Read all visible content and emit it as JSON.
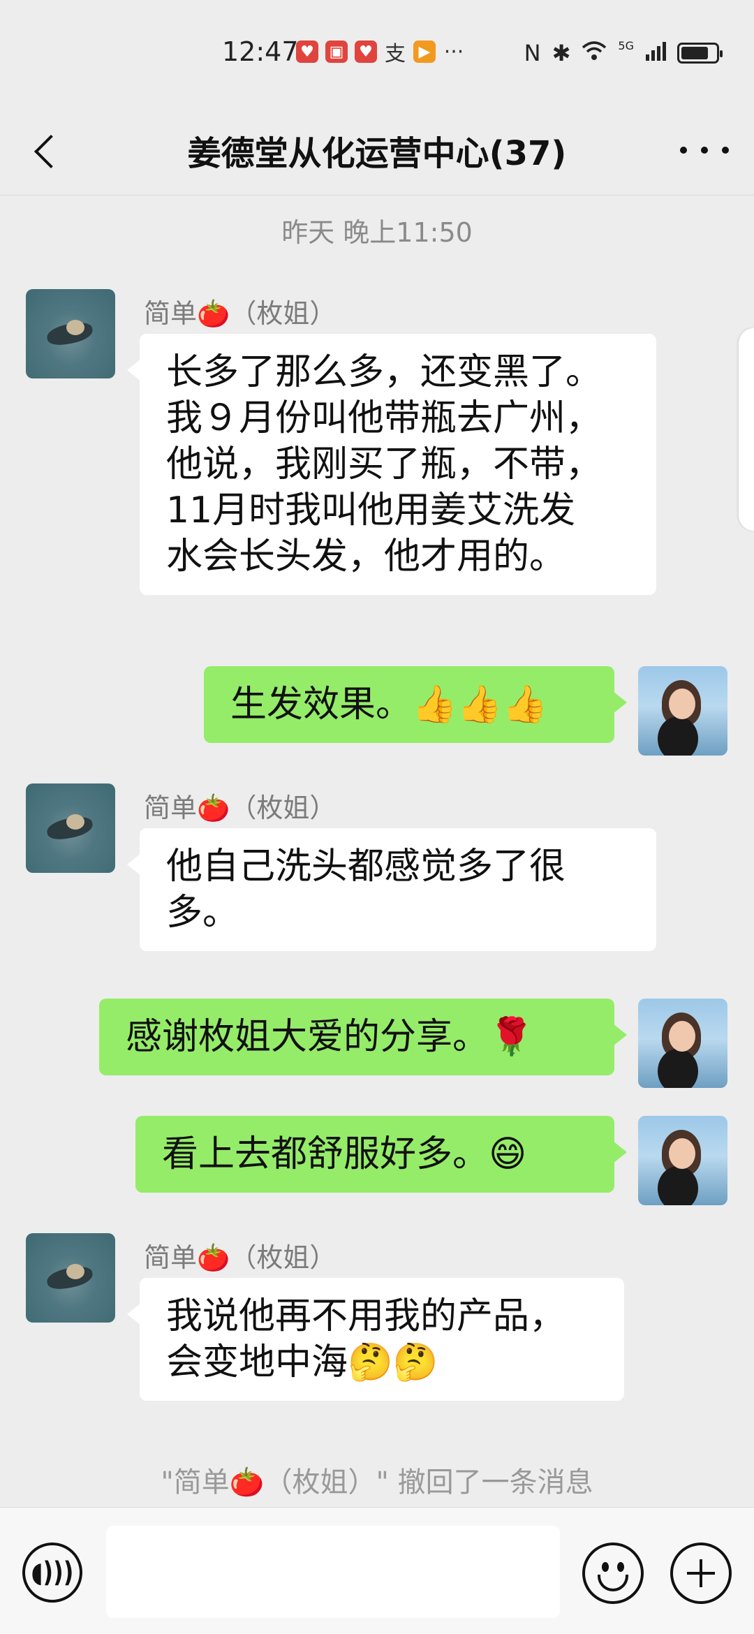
{
  "status_bar": {
    "time": "12:47",
    "app_icons": [
      "pinduoduo-icon",
      "red-book-icon",
      "pinduoduo-icon",
      "alipay-icon",
      "video-icon"
    ],
    "more": "···",
    "nfc": "N",
    "bluetooth": "✱",
    "network": "5G",
    "battery_percent": 80
  },
  "header": {
    "title": "姜德堂从化运营中心(37)"
  },
  "timestamp": "昨天 晚上11:50",
  "messages": [
    {
      "side": "left",
      "sender": "简单🍅（枚姐）",
      "text": "长多了那么多，还变黑了。\n我９月份叫他带瓶去广州，\n他说，我刚买了瓶，不带，\n11月时我叫他用姜艾洗发\n水会长头发，他才用的。"
    },
    {
      "side": "right",
      "text": "生发效果。👍👍👍"
    },
    {
      "side": "left",
      "sender": "简单🍅（枚姐）",
      "text": "他自己洗头都感觉多了很\n多。"
    },
    {
      "side": "right",
      "text": "感谢枚姐大爱的分享。🌹"
    },
    {
      "side": "right",
      "text": "看上去都舒服好多。😄"
    },
    {
      "side": "left",
      "sender": "简单🍅（枚姐）",
      "text": "我说他再不用我的产品，\n会变地中海🤔🤔"
    }
  ],
  "recall_notice": "\"简单🍅（枚姐）\" 撤回了一条消息",
  "input": {
    "value": "",
    "placeholder": ""
  },
  "colors": {
    "background": "#ededed",
    "my_bubble": "#95ec69",
    "their_bubble": "#ffffff"
  }
}
